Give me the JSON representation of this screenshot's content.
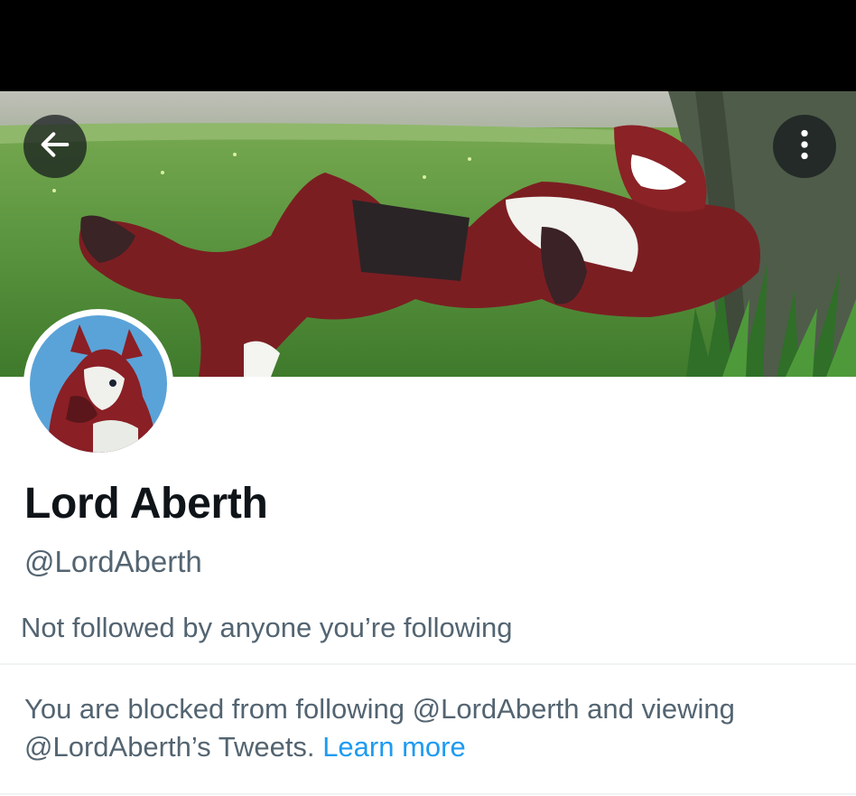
{
  "profile": {
    "display_name": "Lord Aberth",
    "handle": "@LordAberth",
    "followers_note": "Not followed by anyone you’re following"
  },
  "blocked": {
    "message": "You are blocked from following @LordAberth and viewing @LordAberth’s Tweets.",
    "learn_more": "Learn more"
  },
  "icons": {
    "back": "arrow-left-icon",
    "more": "more-vertical-icon"
  },
  "colors": {
    "link": "#1d9bf0",
    "secondary_text": "#536471",
    "primary_text": "#0f1419",
    "status_bar": "#000000"
  }
}
